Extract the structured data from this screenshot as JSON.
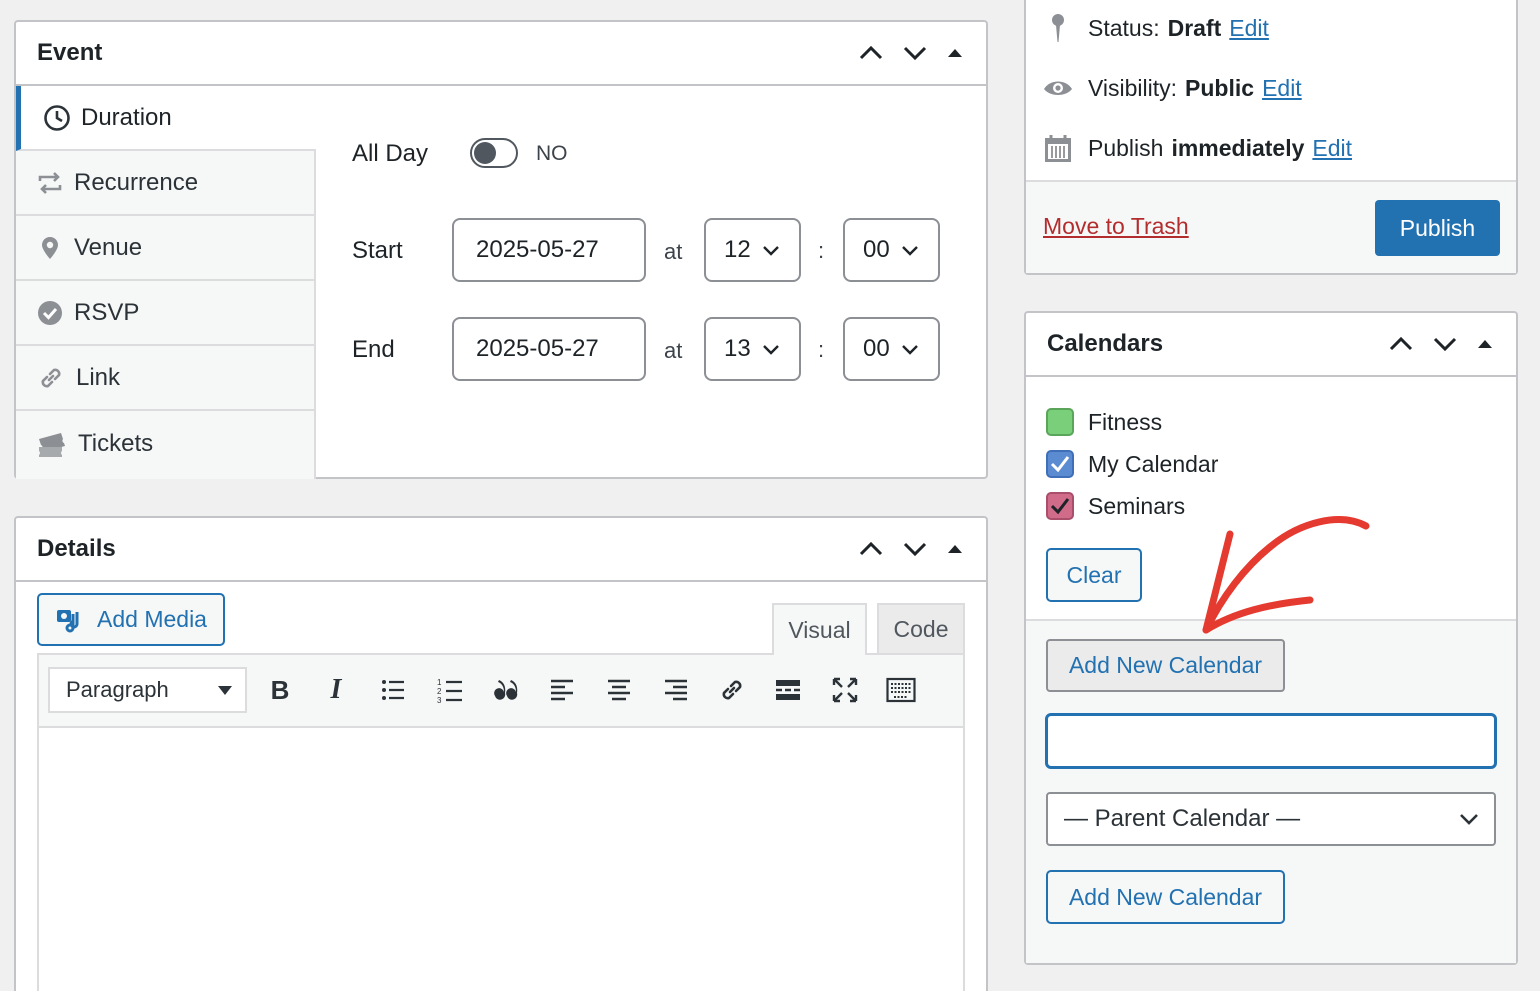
{
  "event_box": {
    "title": "Event",
    "tabs": [
      {
        "label": "Duration",
        "icon": "clock-icon"
      },
      {
        "label": "Recurrence",
        "icon": "repeat-icon"
      },
      {
        "label": "Venue",
        "icon": "location-pin-icon"
      },
      {
        "label": "RSVP",
        "icon": "check-circle-icon"
      },
      {
        "label": "Link",
        "icon": "link-icon"
      },
      {
        "label": "Tickets",
        "icon": "tickets-icon"
      }
    ],
    "all_day_label": "All Day",
    "all_day_value": "NO",
    "start_label": "Start",
    "start_date": "2025-05-27",
    "start_hour": "12",
    "start_minute": "00",
    "end_label": "End",
    "end_date": "2025-05-27",
    "end_hour": "13",
    "end_minute": "00",
    "at_label": "at",
    "colon": ":"
  },
  "details_box": {
    "title": "Details",
    "add_media": "Add Media",
    "tab_visual": "Visual",
    "tab_code": "Code",
    "format_select": "Paragraph"
  },
  "publish_box": {
    "status_label": "Status:",
    "status_value": "Draft",
    "visibility_label": "Visibility:",
    "visibility_value": "Public",
    "publish_label": "Publish",
    "publish_value": "immediately",
    "edit": "Edit",
    "trash": "Move to Trash",
    "publish_button": "Publish"
  },
  "calendars_box": {
    "title": "Calendars",
    "items": [
      {
        "label": "Fitness",
        "checked": false,
        "color": "#7ad07a"
      },
      {
        "label": "My Calendar",
        "checked": true,
        "color": "#5b8bd0"
      },
      {
        "label": "Seminars",
        "checked": true,
        "color": "#d06b8a"
      }
    ],
    "clear": "Clear",
    "add_new_toggle": "Add New Calendar",
    "new_name_value": "",
    "parent_select": "— Parent Calendar —",
    "add_new_submit": "Add New Calendar"
  },
  "colors": {
    "accent": "#2271b1",
    "publish_bg": "#2271b1",
    "trash": "#b32d2e",
    "annotation_arrow": "#e53a2f"
  }
}
